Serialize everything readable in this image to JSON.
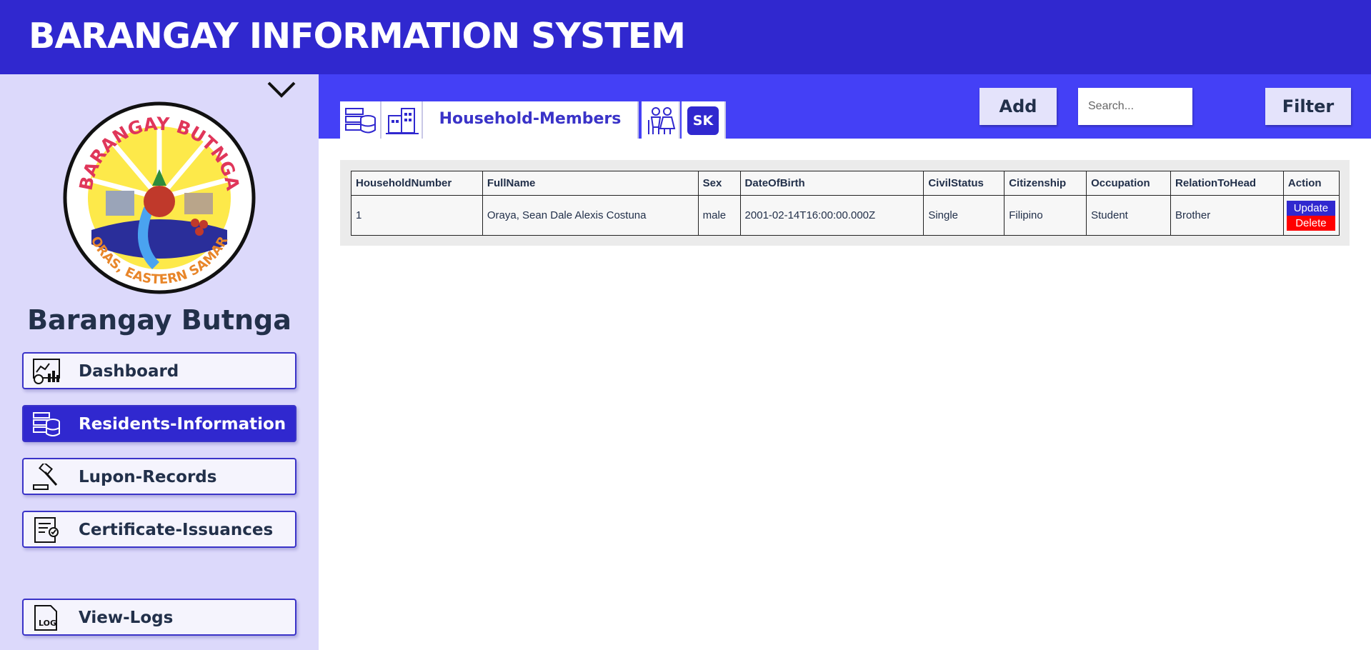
{
  "app": {
    "title": "BARANGAY INFORMATION SYSTEM"
  },
  "sidebar": {
    "barangay_name": "Barangay Butnga",
    "logo_text": {
      "top": "BARANGAY BUTNGA",
      "bottom": "ORAS, EASTERN SAMAR"
    },
    "items": [
      {
        "label": "Dashboard",
        "icon": "dashboard-icon",
        "active": false
      },
      {
        "label": "Residents-Information",
        "icon": "database-icon",
        "active": true
      },
      {
        "label": "Lupon-Records",
        "icon": "gavel-icon",
        "active": false
      },
      {
        "label": "Certificate-Issuances",
        "icon": "certificate-icon",
        "active": false
      },
      {
        "label": "View-Logs",
        "icon": "log-file-icon",
        "active": false
      }
    ],
    "log_icon_text": "LOG"
  },
  "tabs": {
    "residents_icon": "database-icon",
    "households_icon": "buildings-icon",
    "household_members": "Household-Members",
    "seniors_icon": "elderly-couple-icon",
    "sk": "SK"
  },
  "toolbar": {
    "add_label": "Add",
    "search_placeholder": "Search...",
    "filter_label": "Filter"
  },
  "table": {
    "headers": [
      "HouseholdNumber",
      "FullName",
      "Sex",
      "DateOfBirth",
      "CivilStatus",
      "Citizenship",
      "Occupation",
      "RelationToHead",
      "Action"
    ],
    "rows": [
      [
        "1",
        "Oraya, Sean Dale Alexis Costuna",
        "male",
        "2001-02-14T16:00:00.000Z",
        "Single",
        "Filipino",
        "Student",
        "Brother"
      ]
    ],
    "update_label": "Update",
    "delete_label": "Delete"
  },
  "colors": {
    "header_bg": "#3028cf",
    "sidebar_bg": "#dcd9fb",
    "content_bar": "#4440f6",
    "delete": "#ff0000"
  }
}
